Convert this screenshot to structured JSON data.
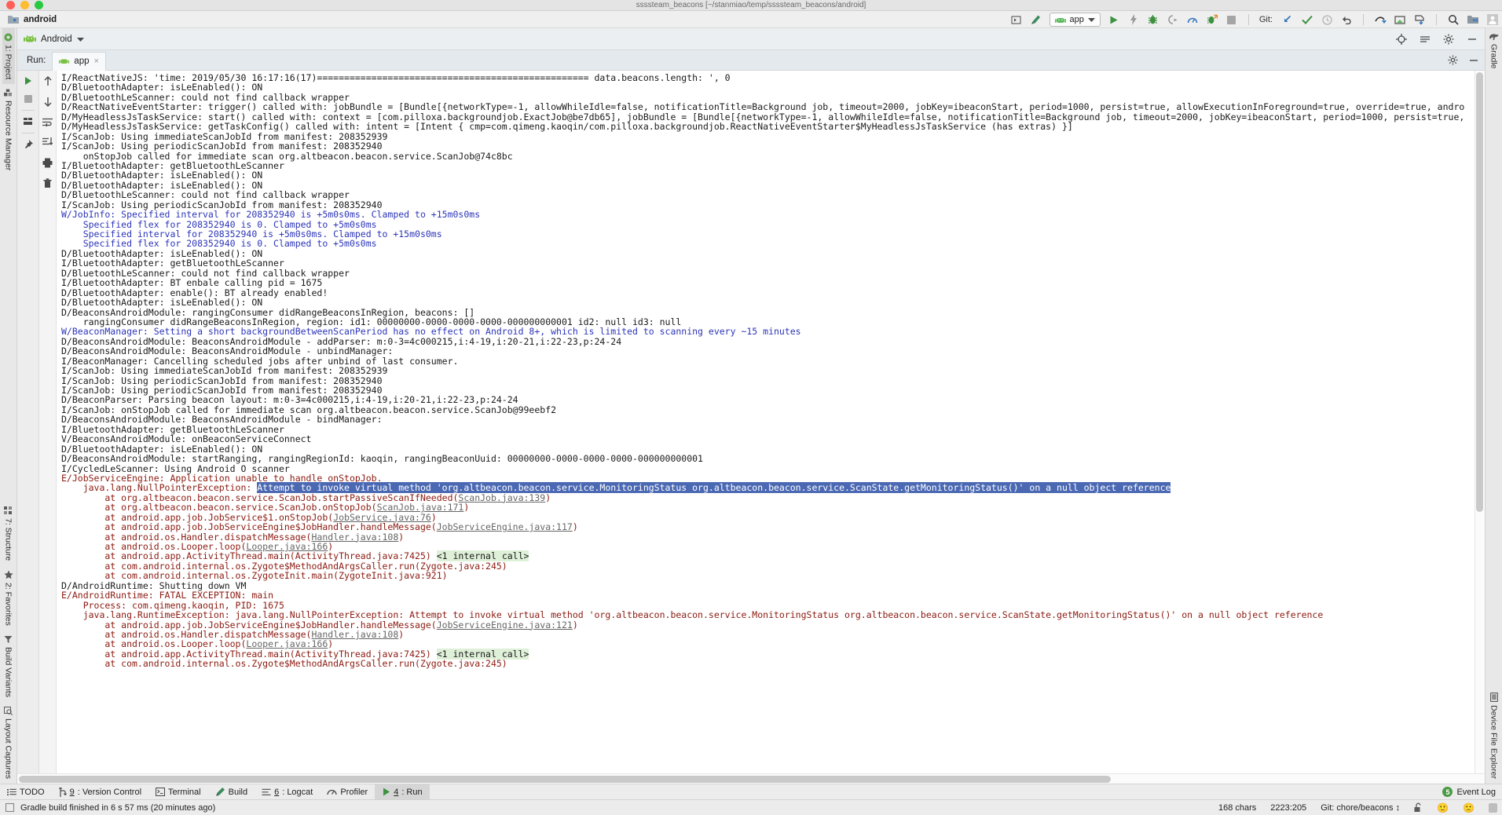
{
  "window": {
    "path_title": "ssssteam_beacons [~/stanmiao/temp/ssssteam_beacons/android]",
    "project_name": "android",
    "traffic_lights": [
      "close",
      "minimize",
      "zoom"
    ]
  },
  "toolbar": {
    "android_dropdown": "Android",
    "run_config": "app",
    "git_label": "Git:",
    "icons": [
      "select-opened-file-icon",
      "build-hammer-icon",
      "run-icon",
      "apply-changes-icon",
      "debug-icon",
      "attach-debugger-icon",
      "profiler-icon",
      "run-with-coverage-icon",
      "stop-icon",
      "update-project-icon",
      "commit-icon",
      "history-icon",
      "revert-icon",
      "push-icon",
      "pull-request-icon",
      "fetch-icon",
      "search-everywhere-icon",
      "project-structure-icon",
      "avatar-icon",
      "settings-gear-icon",
      "minimize-icon",
      "locate-icon",
      "collapse-all-icon"
    ]
  },
  "left_sidebar": {
    "top_items": [
      {
        "label": "1: Project",
        "icon": "project-icon",
        "active": true
      },
      {
        "label": "Resource Manager",
        "icon": "resource-manager-icon",
        "active": false
      }
    ],
    "bottom_items": [
      {
        "label": "7: Structure",
        "icon": "structure-icon"
      },
      {
        "label": "2: Favorites",
        "icon": "star-icon"
      },
      {
        "label": "Build Variants",
        "icon": "build-variants-icon"
      },
      {
        "label": "Layout Captures",
        "icon": "layout-captures-icon"
      }
    ]
  },
  "right_sidebar": {
    "top_items": [
      {
        "label": "Gradle",
        "icon": "gradle-elephant-icon"
      }
    ],
    "bottom_items": [
      {
        "label": "Device File Explorer",
        "icon": "device-file-explorer-icon"
      }
    ]
  },
  "run_window": {
    "title": "Run:",
    "tab_label": "app",
    "tab_close": "×",
    "gutter_icons": [
      "rerun-icon",
      "stop-icon",
      "filter-icon",
      "pin-icon"
    ],
    "gutter2_icons": [
      "scroll-up-icon",
      "scroll-down-icon",
      "soft-wrap-icon",
      "scroll-to-end-icon",
      "print-icon",
      "clear-all-icon"
    ]
  },
  "console": {
    "lines": [
      {
        "t": "d",
        "text": "I/ReactNativeJS: 'time: 2019/05/30 16:17:16(17)================================================== data.beacons.length: ', 0"
      },
      {
        "t": "d",
        "text": "D/BluetoothAdapter: isLeEnabled(): ON"
      },
      {
        "t": "d",
        "text": "D/BluetoothLeScanner: could not find callback wrapper"
      },
      {
        "t": "d",
        "text": "D/ReactNativeEventStarter: trigger() called with: jobBundle = [Bundle[{networkType=-1, allowWhileIdle=false, notificationTitle=Background job, timeout=2000, jobKey=ibeaconStart, period=1000, persist=true, allowExecutionInForeground=true, override=true, andro"
      },
      {
        "t": "d",
        "text": "D/MyHeadlessJsTaskService: start() called with: context = [com.pilloxa.backgroundjob.ExactJob@be7db65], jobBundle = [Bundle[{networkType=-1, allowWhileIdle=false, notificationTitle=Background job, timeout=2000, jobKey=ibeaconStart, period=1000, persist=true,"
      },
      {
        "t": "d",
        "text": "D/MyHeadlessJsTaskService: getTaskConfig() called with: intent = [Intent { cmp=com.qimeng.kaoqin/com.pilloxa.backgroundjob.ReactNativeEventStarter$MyHeadlessJsTaskService (has extras) }]"
      },
      {
        "t": "d",
        "text": "I/ScanJob: Using immediateScanJobId from manifest: 208352939"
      },
      {
        "t": "d",
        "text": "I/ScanJob: Using periodicScanJobId from manifest: 208352940"
      },
      {
        "t": "d",
        "text": "    onStopJob called for immediate scan org.altbeacon.beacon.service.ScanJob@74c8bc"
      },
      {
        "t": "d",
        "text": "I/BluetoothAdapter: getBluetoothLeScanner"
      },
      {
        "t": "d",
        "text": "D/BluetoothAdapter: isLeEnabled(): ON"
      },
      {
        "t": "d",
        "text": "D/BluetoothAdapter: isLeEnabled(): ON"
      },
      {
        "t": "d",
        "text": "D/BluetoothLeScanner: could not find callback wrapper"
      },
      {
        "t": "d",
        "text": "I/ScanJob: Using periodicScanJobId from manifest: 208352940"
      },
      {
        "t": "w",
        "text": "W/JobInfo: Specified interval for 208352940 is +5m0s0ms. Clamped to +15m0s0ms"
      },
      {
        "t": "w",
        "text": "    Specified flex for 208352940 is 0. Clamped to +5m0s0ms"
      },
      {
        "t": "w",
        "text": "    Specified interval for 208352940 is +5m0s0ms. Clamped to +15m0s0ms"
      },
      {
        "t": "w",
        "text": "    Specified flex for 208352940 is 0. Clamped to +5m0s0ms"
      },
      {
        "t": "d",
        "text": "D/BluetoothAdapter: isLeEnabled(): ON"
      },
      {
        "t": "d",
        "text": "I/BluetoothAdapter: getBluetoothLeScanner"
      },
      {
        "t": "d",
        "text": "D/BluetoothLeScanner: could not find callback wrapper"
      },
      {
        "t": "d",
        "text": "I/BluetoothAdapter: BT enbale calling pid = 1675"
      },
      {
        "t": "d",
        "text": "D/BluetoothAdapter: enable(): BT already enabled!"
      },
      {
        "t": "d",
        "text": "D/BluetoothAdapter: isLeEnabled(): ON"
      },
      {
        "t": "d",
        "text": "D/BeaconsAndroidModule: rangingConsumer didRangeBeaconsInRegion, beacons: []"
      },
      {
        "t": "d",
        "text": "    rangingConsumer didRangeBeaconsInRegion, region: id1: 00000000-0000-0000-0000-000000000001 id2: null id3: null"
      },
      {
        "t": "w",
        "text": "W/BeaconManager: Setting a short backgroundBetweenScanPeriod has no effect on Android 8+, which is limited to scanning every ~15 minutes"
      },
      {
        "t": "d",
        "text": "D/BeaconsAndroidModule: BeaconsAndroidModule - addParser: m:0-3=4c000215,i:4-19,i:20-21,i:22-23,p:24-24"
      },
      {
        "t": "d",
        "text": "D/BeaconsAndroidModule: BeaconsAndroidModule - unbindManager:"
      },
      {
        "t": "d",
        "text": "I/BeaconManager: Cancelling scheduled jobs after unbind of last consumer."
      },
      {
        "t": "d",
        "text": "I/ScanJob: Using immediateScanJobId from manifest: 208352939"
      },
      {
        "t": "d",
        "text": "I/ScanJob: Using periodicScanJobId from manifest: 208352940"
      },
      {
        "t": "d",
        "text": "I/ScanJob: Using periodicScanJobId from manifest: 208352940"
      },
      {
        "t": "d",
        "text": "D/BeaconParser: Parsing beacon layout: m:0-3=4c000215,i:4-19,i:20-21,i:22-23,p:24-24"
      },
      {
        "t": "d",
        "text": "I/ScanJob: onStopJob called for immediate scan org.altbeacon.beacon.service.ScanJob@99eebf2"
      },
      {
        "t": "d",
        "text": "D/BeaconsAndroidModule: BeaconsAndroidModule - bindManager:"
      },
      {
        "t": "d",
        "text": "I/BluetoothAdapter: getBluetoothLeScanner"
      },
      {
        "t": "d",
        "text": "V/BeaconsAndroidModule: onBeaconServiceConnect"
      },
      {
        "t": "d",
        "text": "D/BluetoothAdapter: isLeEnabled(): ON"
      },
      {
        "t": "d",
        "text": "D/BeaconsAndroidModule: startRanging, rangingRegionId: kaoqin, rangingBeaconUuid: 00000000-0000-0000-0000-000000000001"
      },
      {
        "t": "d",
        "text": "I/CycledLeScanner: Using Android O scanner"
      }
    ],
    "error_block": {
      "header": "E/JobServiceEngine: Application unable to handle onStopJob.",
      "exception_prefix": "    java.lang.NullPointerException: ",
      "exception_selected": "Attempt to invoke virtual method 'org.altbeacon.beacon.service.MonitoringStatus org.altbeacon.beacon.service.ScanState.getMonitoringStatus()' on a null object reference",
      "stack": [
        {
          "pre": "        at org.altbeacon.beacon.service.ScanJob.startPassiveScanIfNeeded(",
          "link": "ScanJob.java:139",
          "post": ")"
        },
        {
          "pre": "        at org.altbeacon.beacon.service.ScanJob.onStopJob(",
          "link": "ScanJob.java:171",
          "post": ")"
        },
        {
          "pre": "        at android.app.job.JobService$1.onStopJob(",
          "link": "JobService.java:76",
          "post": ")"
        },
        {
          "pre": "        at android.app.job.JobServiceEngine$JobHandler.handleMessage(",
          "link": "JobServiceEngine.java:117",
          "post": ")"
        },
        {
          "pre": "        at android.os.Handler.dispatchMessage(",
          "link": "Handler.java:108",
          "post": ")"
        },
        {
          "pre": "        at android.os.Looper.loop(",
          "link": "Looper.java:166",
          "post": ")"
        },
        {
          "pre": "        at android.app.ActivityThread.main(ActivityThread.java:7425) ",
          "link": "",
          "post": "",
          "green": "<1 internal call>",
          "fold": true
        },
        {
          "pre": "        at com.android.internal.os.Zygote$MethodAndArgsCaller.run(Zygote.java:245)",
          "link": "",
          "post": ""
        },
        {
          "pre": "        at com.android.internal.os.ZygoteInit.main(ZygoteInit.java:921)",
          "link": "",
          "post": ""
        }
      ]
    },
    "fatal_block": {
      "lines": [
        {
          "t": "d",
          "text": "D/AndroidRuntime: Shutting down VM"
        },
        {
          "t": "e",
          "text": "E/AndroidRuntime: FATAL EXCEPTION: main"
        },
        {
          "t": "e",
          "text": "    Process: com.qimeng.kaoqin, PID: 1675"
        },
        {
          "t": "e",
          "text": "    java.lang.RuntimeException: java.lang.NullPointerException: Attempt to invoke virtual method 'org.altbeacon.beacon.service.MonitoringStatus org.altbeacon.beacon.service.ScanState.getMonitoringStatus()' on a null object reference"
        }
      ],
      "stack": [
        {
          "pre": "        at android.app.job.JobServiceEngine$JobHandler.handleMessage(",
          "link": "JobServiceEngine.java:121",
          "post": ")"
        },
        {
          "pre": "        at android.os.Handler.dispatchMessage(",
          "link": "Handler.java:108",
          "post": ")"
        },
        {
          "pre": "        at android.os.Looper.loop(",
          "link": "Looper.java:166",
          "post": ")"
        },
        {
          "pre": "        at android.app.ActivityThread.main(ActivityThread.java:7425) ",
          "link": "",
          "post": "",
          "green": "<1 internal call>",
          "fold": true
        },
        {
          "pre": "        at com.android.internal.os.Zygote$MethodAndArgsCaller.run(Zygote.java:245)",
          "link": "",
          "post": ""
        }
      ]
    }
  },
  "tool_strip": {
    "items": [
      {
        "label": "TODO",
        "icon": "todo-icon",
        "mnemonic": "",
        "active": false
      },
      {
        "label": ": Version Control",
        "icon": "vcs-branch-icon",
        "mnemonic": "9",
        "active": false
      },
      {
        "label": "Terminal",
        "icon": "terminal-icon",
        "mnemonic": "",
        "active": false
      },
      {
        "label": "Build",
        "icon": "build-hammer-icon",
        "mnemonic": "",
        "active": false
      },
      {
        "label": ": Logcat",
        "icon": "logcat-icon",
        "mnemonic": "6",
        "active": false
      },
      {
        "label": "Profiler",
        "icon": "profiler-icon",
        "mnemonic": "",
        "active": false
      },
      {
        "label": ": Run",
        "icon": "run-icon",
        "mnemonic": "4",
        "active": true
      }
    ],
    "event_log": {
      "label": "Event Log",
      "badge": "5"
    }
  },
  "status_bar": {
    "message": "Gradle build finished in 6 s 57 ms (20 minutes ago)",
    "chars": "168 chars",
    "caret": "2223:205",
    "git_branch": "Git: chore/beacons",
    "lock_icon": "unlocked-padlock-icon",
    "happy_icon": "happy-face-icon",
    "sad_icon": "sad-face-icon",
    "memory_icon": "memory-indicator-icon"
  },
  "colors": {
    "debug": "#1a1a1a",
    "warn": "#2c35b8",
    "error": "#8b1a10",
    "selection": "#4b69b3",
    "green_highlight": "#dff0d8",
    "accent_green": "#4a9a45"
  }
}
